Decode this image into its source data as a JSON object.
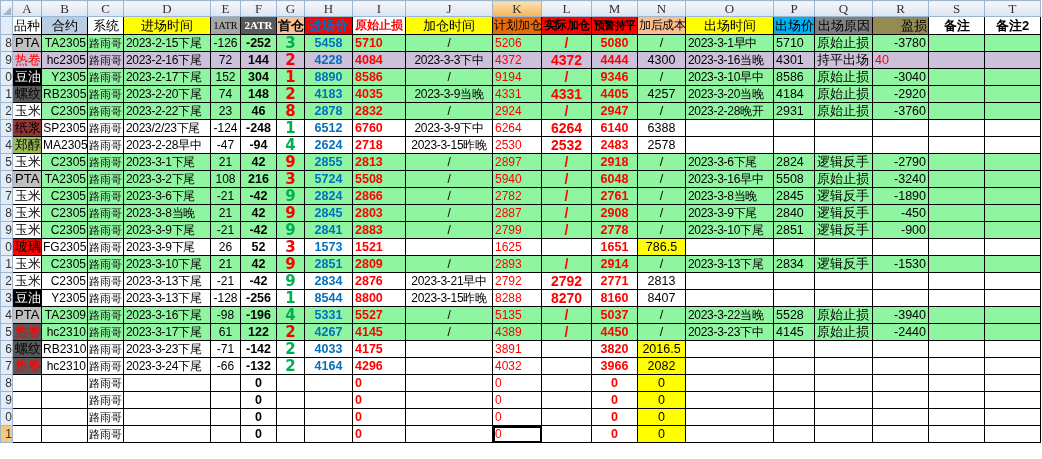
{
  "column_letters": [
    {
      "letter": "A",
      "selected": false
    },
    {
      "letter": "B",
      "selected": false
    },
    {
      "letter": "C",
      "selected": false
    },
    {
      "letter": "D",
      "selected": false
    },
    {
      "letter": "E",
      "selected": false
    },
    {
      "letter": "F",
      "selected": false
    },
    {
      "letter": "G",
      "selected": false
    },
    {
      "letter": "H",
      "selected": false
    },
    {
      "letter": "I",
      "selected": false
    },
    {
      "letter": "J",
      "selected": false
    },
    {
      "letter": "K",
      "selected": true
    },
    {
      "letter": "L",
      "selected": false
    },
    {
      "letter": "M",
      "selected": false
    },
    {
      "letter": "N",
      "selected": false
    },
    {
      "letter": "O",
      "selected": false
    },
    {
      "letter": "P",
      "selected": false
    },
    {
      "letter": "Q",
      "selected": false
    },
    {
      "letter": "R",
      "selected": false
    },
    {
      "letter": "S",
      "selected": false
    },
    {
      "letter": "T",
      "selected": false
    }
  ],
  "headers": [
    "品种",
    "合约",
    "系统",
    "进场时间",
    "1ATR",
    "2ATR",
    "首仓",
    "进场价",
    "原始止损",
    "加仓时间",
    "计划加仓",
    "实际加仓",
    "预警持平",
    "加后成本",
    "出场时间",
    "出场价",
    "出场原因",
    "盈损",
    "备注",
    "备注2"
  ],
  "rows": [
    {
      "number": "8",
      "selected": false,
      "color": "#90f5a0",
      "variety": {
        "text": "PTA",
        "color": "#c0c0c0",
        "kind": "plain"
      },
      "contract": "TA2305",
      "system": "路雨哥",
      "entry_time": "2023-2-15下尾",
      "atr_1": "-126",
      "atr_2": "-252",
      "first_position": {
        "text": "3",
        "kind": "short"
      },
      "entry_price": "5458",
      "initial_stop": "5710",
      "add_time": "/",
      "planned_add": "5206",
      "actual_add": "/",
      "warning_breakeven": "5080",
      "cost_after_add": "/",
      "cost_highlight": false,
      "exit_time": "2023-3-1早中",
      "exit_price": "5710",
      "exit_reason": "原始止损",
      "pnl": {
        "text": "-3780",
        "kind": "plain"
      }
    },
    {
      "number": "9",
      "selected": false,
      "color": "#ccc0da",
      "variety": {
        "text": "热卷",
        "color": "#ccc0da",
        "kind": "alert"
      },
      "contract": "hc2305",
      "system": "路雨哥",
      "entry_time": "2023-2-16下尾",
      "atr_1": "72",
      "atr_2": "144",
      "first_position": {
        "text": "2",
        "kind": "long"
      },
      "entry_price": "4228",
      "initial_stop": "4084",
      "add_time": "2023-3-3下中",
      "planned_add": "4372",
      "actual_add": "4372",
      "warning_breakeven": "4444",
      "cost_after_add": "4300",
      "cost_highlight": false,
      "exit_time": "2023-3-16当晚",
      "exit_price": "4301",
      "exit_reason": "持平出场",
      "pnl": {
        "text": "40",
        "kind": "alert"
      }
    },
    {
      "number": "0",
      "selected": false,
      "color": "#90f5a0",
      "variety": {
        "text": "豆油",
        "color": "#000000",
        "kind": "inverse"
      },
      "contract": "Y2305",
      "system": "路雨哥",
      "entry_time": "2023-2-17下尾",
      "atr_1": "152",
      "atr_2": "304",
      "first_position": {
        "text": "1",
        "kind": "long"
      },
      "entry_price": "8890",
      "initial_stop": "8586",
      "add_time": "/",
      "planned_add": "9194",
      "actual_add": "/",
      "warning_breakeven": "9346",
      "cost_after_add": "/",
      "cost_highlight": false,
      "exit_time": "2023-3-10早中",
      "exit_price": "8586",
      "exit_reason": "原始止损",
      "pnl": {
        "text": "-3040",
        "kind": "plain"
      }
    },
    {
      "number": "1",
      "selected": false,
      "color": "#90f5a0",
      "variety": {
        "text": "螺纹",
        "color": "#595959",
        "kind": "plain"
      },
      "contract": "RB2305",
      "system": "路雨哥",
      "entry_time": "2023-2-20下尾",
      "atr_1": "74",
      "atr_2": "148",
      "first_position": {
        "text": "2",
        "kind": "long"
      },
      "entry_price": "4183",
      "initial_stop": "4035",
      "add_time": "2023-3-9当晚",
      "planned_add": "4331",
      "actual_add": "4331",
      "warning_breakeven": "4405",
      "cost_after_add": "4257",
      "cost_highlight": false,
      "exit_time": "2023-3-20当晚",
      "exit_price": "4184",
      "exit_reason": "原始止损",
      "pnl": {
        "text": "-2920",
        "kind": "plain"
      }
    },
    {
      "number": "2",
      "selected": false,
      "color": "#90f5a0",
      "variety": {
        "text": "玉米",
        "color": "#ffffff",
        "kind": "plain"
      },
      "contract": "C2305",
      "system": "路雨哥",
      "entry_time": "2023-2-22下尾",
      "atr_1": "23",
      "atr_2": "46",
      "first_position": {
        "text": "8",
        "kind": "long"
      },
      "entry_price": "2878",
      "initial_stop": "2832",
      "add_time": "/",
      "planned_add": "2924",
      "actual_add": "/",
      "warning_breakeven": "2947",
      "cost_after_add": "/",
      "cost_highlight": false,
      "exit_time": "2023-2-28晚开",
      "exit_price": "2931",
      "exit_reason": "原始止损",
      "pnl": {
        "text": "-3760",
        "kind": "plain"
      }
    },
    {
      "number": "3",
      "selected": false,
      "color": "#ffffff",
      "variety": {
        "text": "纸浆",
        "color": "#963634",
        "kind": "plain"
      },
      "contract": "SP2305",
      "system": "路雨哥",
      "entry_time": "2023/2/23下尾",
      "atr_1": "-124",
      "atr_2": "-248",
      "first_position": {
        "text": "1",
        "kind": "short"
      },
      "entry_price": "6512",
      "initial_stop": "6760",
      "add_time": "2023-3-9下中",
      "planned_add": "6264",
      "actual_add": "6264",
      "warning_breakeven": "6140",
      "cost_after_add": "6388",
      "cost_highlight": false
    },
    {
      "number": "4",
      "selected": false,
      "color": "#ffffff",
      "variety": {
        "text": "郑醇",
        "color": "#9bbb59",
        "kind": "plain"
      },
      "contract": "MA2305",
      "system": "路雨哥",
      "entry_time": "2023-2-28早中",
      "atr_1": "-47",
      "atr_2": "-94",
      "first_position": {
        "text": "4",
        "kind": "short"
      },
      "entry_price": "2624",
      "initial_stop": "2718",
      "add_time": "2023-3-15昨晚",
      "planned_add": "2530",
      "actual_add": "2532",
      "warning_breakeven": "2483",
      "cost_after_add": "2578",
      "cost_highlight": false
    },
    {
      "number": "5",
      "selected": false,
      "color": "#90f5a0",
      "variety": {
        "text": "玉米",
        "color": "#ffffff",
        "kind": "plain"
      },
      "contract": "C2305",
      "system": "路雨哥",
      "entry_time": "2023-3-1下尾",
      "atr_1": "21",
      "atr_2": "42",
      "first_position": {
        "text": "9",
        "kind": "long"
      },
      "entry_price": "2855",
      "initial_stop": "2813",
      "add_time": "/",
      "planned_add": "2897",
      "actual_add": "/",
      "warning_breakeven": "2918",
      "cost_after_add": "/",
      "cost_highlight": false,
      "exit_time": "2023-3-6下尾",
      "exit_price": "2824",
      "exit_reason": "逻辑反手",
      "pnl": {
        "text": "-2790",
        "kind": "plain"
      }
    },
    {
      "number": "6",
      "selected": false,
      "color": "#90f5a0",
      "variety": {
        "text": "PTA",
        "color": "#c0c0c0",
        "kind": "plain"
      },
      "contract": "TA2305",
      "system": "路雨哥",
      "entry_time": "2023-3-2下尾",
      "atr_1": "108",
      "atr_2": "216",
      "first_position": {
        "text": "3",
        "kind": "long"
      },
      "entry_price": "5724",
      "initial_stop": "5508",
      "add_time": "/",
      "planned_add": "5940",
      "actual_add": "/",
      "warning_breakeven": "6048",
      "cost_after_add": "/",
      "cost_highlight": false,
      "exit_time": "2023-3-16早中",
      "exit_price": "5508",
      "exit_reason": "原始止损",
      "pnl": {
        "text": "-3240",
        "kind": "plain"
      }
    },
    {
      "number": "7",
      "selected": false,
      "color": "#90f5a0",
      "variety": {
        "text": "玉米",
        "color": "#ffffff",
        "kind": "plain"
      },
      "contract": "C2305",
      "system": "路雨哥",
      "entry_time": "2023-3-6下尾",
      "atr_1": "-21",
      "atr_2": "-42",
      "first_position": {
        "text": "9",
        "kind": "short"
      },
      "entry_price": "2824",
      "initial_stop": "2866",
      "add_time": "/",
      "planned_add": "2782",
      "actual_add": "/",
      "warning_breakeven": "2761",
      "cost_after_add": "/",
      "cost_highlight": false,
      "exit_time": "2023-3-8当晚",
      "exit_price": "2845",
      "exit_reason": "逻辑反手",
      "pnl": {
        "text": "-1890",
        "kind": "plain"
      }
    },
    {
      "number": "8",
      "selected": false,
      "color": "#90f5a0",
      "variety": {
        "text": "玉米",
        "color": "#ffffff",
        "kind": "plain"
      },
      "contract": "C2305",
      "system": "路雨哥",
      "entry_time": "2023-3-8当晚",
      "atr_1": "21",
      "atr_2": "42",
      "first_position": {
        "text": "9",
        "kind": "long"
      },
      "entry_price": "2845",
      "initial_stop": "2803",
      "add_time": "/",
      "planned_add": "2887",
      "actual_add": "/",
      "warning_breakeven": "2908",
      "cost_after_add": "/",
      "cost_highlight": false,
      "exit_time": "2023-3-9下尾",
      "exit_price": "2840",
      "exit_reason": "逻辑反手",
      "pnl": {
        "text": "-450",
        "kind": "plain"
      }
    },
    {
      "number": "9",
      "selected": false,
      "color": "#90f5a0",
      "variety": {
        "text": "玉米",
        "color": "#ffffff",
        "kind": "plain"
      },
      "contract": "C2305",
      "system": "路雨哥",
      "entry_time": "2023-3-9下尾",
      "atr_1": "-21",
      "atr_2": "-42",
      "first_position": {
        "text": "9",
        "kind": "short"
      },
      "entry_price": "2841",
      "initial_stop": "2883",
      "add_time": "/",
      "planned_add": "2799",
      "actual_add": "/",
      "warning_breakeven": "2778",
      "cost_after_add": "/",
      "cost_highlight": false,
      "exit_time": "2023-3-10下尾",
      "exit_price": "2851",
      "exit_reason": "逻辑反手",
      "pnl": {
        "text": "-900",
        "kind": "plain"
      }
    },
    {
      "number": "0",
      "selected": false,
      "color": "#ffffff",
      "variety": {
        "text": "玻璃",
        "color": "#ff0000",
        "kind": "plain"
      },
      "contract": "FG2305",
      "system": "路雨哥",
      "entry_time": "2023-3-9下尾",
      "atr_1": "26",
      "atr_2": "52",
      "first_position": {
        "text": "3",
        "kind": "long"
      },
      "entry_price": "1573",
      "initial_stop": "1521",
      "planned_add": "1625",
      "warning_breakeven": "1651",
      "cost_after_add": "786.5",
      "cost_highlight": true
    },
    {
      "number": "1",
      "selected": false,
      "color": "#90f5a0",
      "variety": {
        "text": "玉米",
        "color": "#ffffff",
        "kind": "plain"
      },
      "contract": "C2305",
      "system": "路雨哥",
      "entry_time": "2023-3-10下尾",
      "atr_1": "21",
      "atr_2": "42",
      "first_position": {
        "text": "9",
        "kind": "long"
      },
      "entry_price": "2851",
      "initial_stop": "2809",
      "add_time": "/",
      "planned_add": "2893",
      "actual_add": "/",
      "warning_breakeven": "2914",
      "cost_after_add": "/",
      "cost_highlight": false,
      "exit_time": "2023-3-13下尾",
      "exit_price": "2834",
      "exit_reason": "逻辑反手",
      "pnl": {
        "text": "-1530",
        "kind": "plain"
      }
    },
    {
      "number": "2",
      "selected": false,
      "color": "#ffffff",
      "variety": {
        "text": "玉米",
        "color": "#ffffff",
        "kind": "plain"
      },
      "contract": "C2305",
      "system": "路雨哥",
      "entry_time": "2023-3-13下尾",
      "atr_1": "-21",
      "atr_2": "-42",
      "first_position": {
        "text": "9",
        "kind": "short"
      },
      "entry_price": "2834",
      "initial_stop": "2876",
      "add_time": "2023-3-21早中",
      "planned_add": "2792",
      "actual_add": "2792",
      "warning_breakeven": "2771",
      "cost_after_add": "2813",
      "cost_highlight": false
    },
    {
      "number": "3",
      "selected": false,
      "color": "#ffffff",
      "variety": {
        "text": "豆油",
        "color": "#000000",
        "kind": "inverse"
      },
      "contract": "Y2305",
      "system": "路雨哥",
      "entry_time": "2023-3-13下尾",
      "atr_1": "-128",
      "atr_2": "-256",
      "first_position": {
        "text": "1",
        "kind": "short"
      },
      "entry_price": "8544",
      "initial_stop": "8800",
      "add_time": "2023-3-15昨晚",
      "planned_add": "8288",
      "actual_add": "8270",
      "warning_breakeven": "8160",
      "cost_after_add": "8407",
      "cost_highlight": false
    },
    {
      "number": "4",
      "selected": false,
      "color": "#90f5a0",
      "variety": {
        "text": "PTA",
        "color": "#c0c0c0",
        "kind": "plain"
      },
      "contract": "TA2309",
      "system": "路雨哥",
      "entry_time": "2023-3-16下尾",
      "atr_1": "-98",
      "atr_2": "-196",
      "first_position": {
        "text": "4",
        "kind": "short"
      },
      "entry_price": "5331",
      "initial_stop": "5527",
      "add_time": "/",
      "planned_add": "5135",
      "actual_add": "/",
      "warning_breakeven": "5037",
      "cost_after_add": "/",
      "cost_highlight": false,
      "exit_time": "2023-3-22当晚",
      "exit_price": "5528",
      "exit_reason": "原始止损",
      "pnl": {
        "text": "-3940",
        "kind": "plain"
      }
    },
    {
      "number": "5",
      "selected": false,
      "color": "#90f5a0",
      "variety": {
        "text": "热卷",
        "color": "#595959",
        "kind": "alert"
      },
      "contract": "hc2310",
      "system": "路雨哥",
      "entry_time": "2023-3-17下尾",
      "atr_1": "61",
      "atr_2": "122",
      "first_position": {
        "text": "2",
        "kind": "long"
      },
      "entry_price": "4267",
      "initial_stop": "4145",
      "add_time": "/",
      "planned_add": "4389",
      "actual_add": "/",
      "warning_breakeven": "4450",
      "cost_after_add": "/",
      "cost_highlight": false,
      "exit_time": "2023-3-23下中",
      "exit_price": "4145",
      "exit_reason": "原始止损",
      "pnl": {
        "text": "-2440",
        "kind": "plain"
      }
    },
    {
      "number": "6",
      "selected": false,
      "color": "#ffffff",
      "variety": {
        "text": "螺纹",
        "color": "#595959",
        "kind": "plain"
      },
      "contract": "RB2310",
      "system": "路雨哥",
      "entry_time": "2023-3-23下尾",
      "atr_1": "-71",
      "atr_2": "-142",
      "first_position": {
        "text": "2",
        "kind": "short"
      },
      "entry_price": "4033",
      "initial_stop": "4175",
      "planned_add": "3891",
      "warning_breakeven": "3820",
      "cost_after_add": "2016.5",
      "cost_highlight": true
    },
    {
      "number": "7",
      "selected": false,
      "color": "#ffffff",
      "variety": {
        "text": "热卷",
        "color": "#595959",
        "kind": "alert"
      },
      "contract": "hc2310",
      "system": "路雨哥",
      "entry_time": "2023-3-24下尾",
      "atr_1": "-66",
      "atr_2": "-132",
      "first_position": {
        "text": "2",
        "kind": "short"
      },
      "entry_price": "4164",
      "initial_stop": "4296",
      "planned_add": "4032",
      "warning_breakeven": "3966",
      "cost_after_add": "2082",
      "cost_highlight": true
    },
    {
      "number": "8",
      "selected": false,
      "color": "#ffffff",
      "system": "路雨哥",
      "atr_2": "0",
      "initial_stop": "0",
      "planned_add": "0",
      "warning_breakeven": "0",
      "cost_after_add": "0",
      "cost_highlight": true
    },
    {
      "number": "9",
      "selected": false,
      "color": "#ffffff",
      "system": "路雨哥",
      "atr_2": "0",
      "initial_stop": "0",
      "planned_add": "0",
      "warning_breakeven": "0",
      "cost_after_add": "0",
      "cost_highlight": true
    },
    {
      "number": "0",
      "selected": false,
      "color": "#ffffff",
      "system": "路雨哥",
      "atr_2": "0",
      "initial_stop": "0",
      "planned_add": "0",
      "warning_breakeven": "0",
      "cost_after_add": "0",
      "cost_highlight": true
    },
    {
      "number": "1",
      "selected": true,
      "color": "#ffffff",
      "system": "路雨哥",
      "atr_2": "0",
      "initial_stop": "0",
      "planned_add": "0",
      "warning_breakeven": "0",
      "cost_after_add": "0",
      "cost_highlight": true
    }
  ]
}
